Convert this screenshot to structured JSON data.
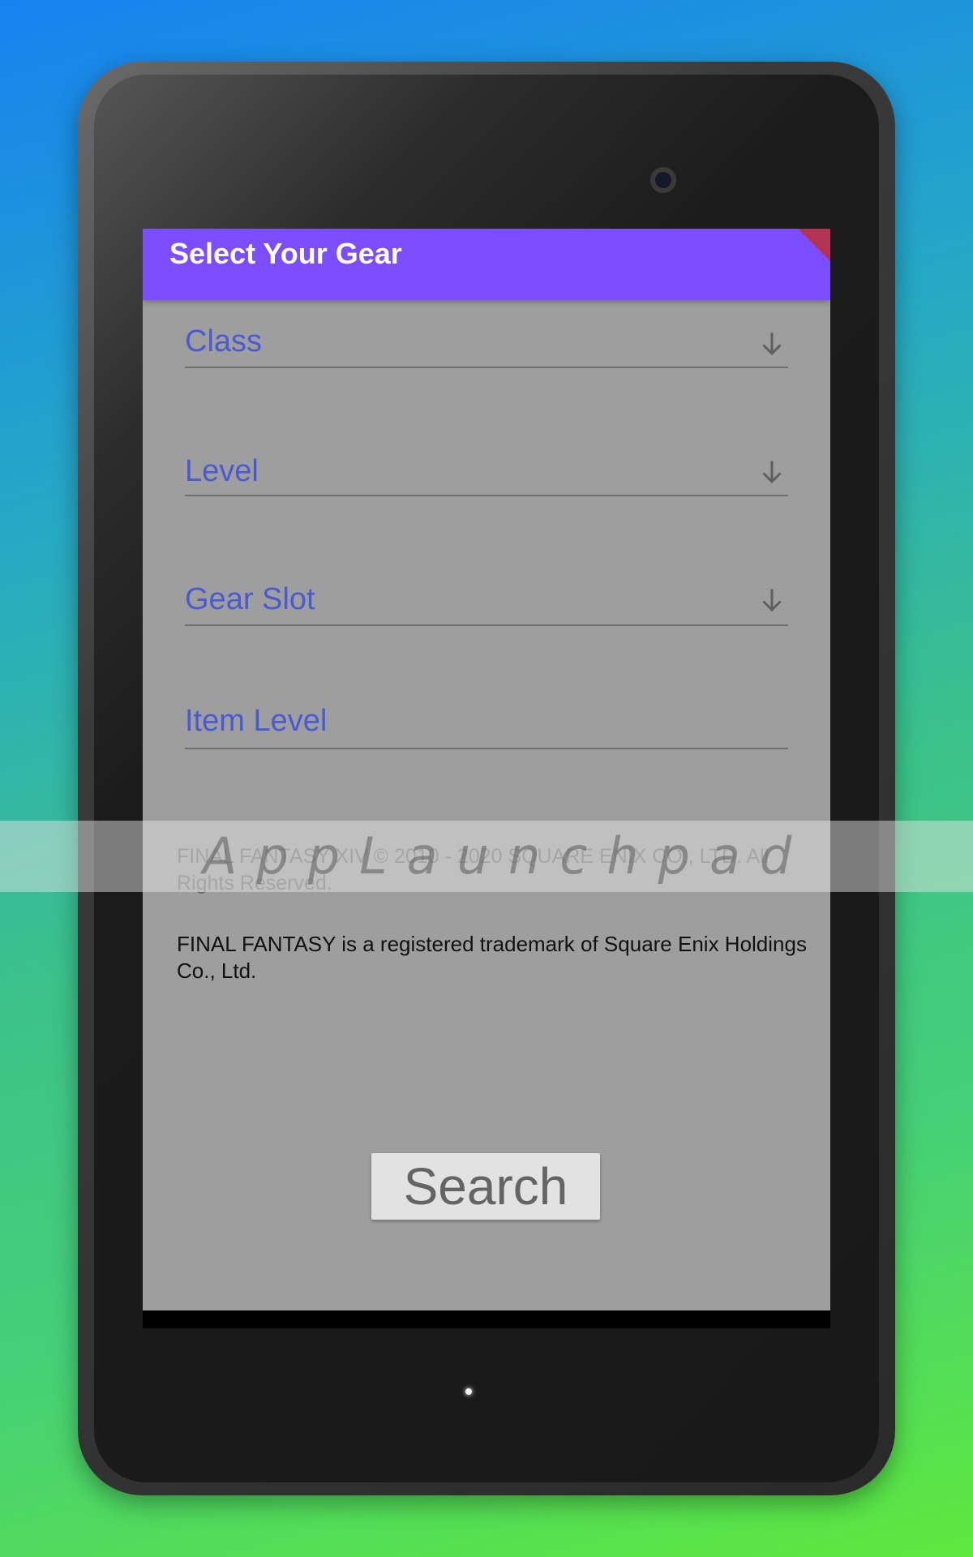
{
  "app": {
    "title": "Select Your Gear"
  },
  "form": {
    "fields": [
      {
        "label": "Class",
        "icon": "arrow-down-icon"
      },
      {
        "label": "Level",
        "icon": "arrow-down-icon"
      },
      {
        "label": "Gear Slot",
        "icon": "arrow-down-icon"
      }
    ],
    "item_level": {
      "label": "Item Level"
    }
  },
  "legal": {
    "copyright": "FINAL FANTASY XIV © 2010 - 2020 SQUARE ENIX CO., LTD. All Rights Reserved.",
    "trademark": "FINAL FANTASY is a registered trademark of Square Enix Holdings Co., Ltd."
  },
  "actions": {
    "search_label": "Search"
  },
  "overlay": {
    "watermark": "AppLaunchpad"
  },
  "colors": {
    "appbar": "#7c4dff",
    "label_accent": "#4a5ad3",
    "background_dim": "#9e9e9e"
  }
}
